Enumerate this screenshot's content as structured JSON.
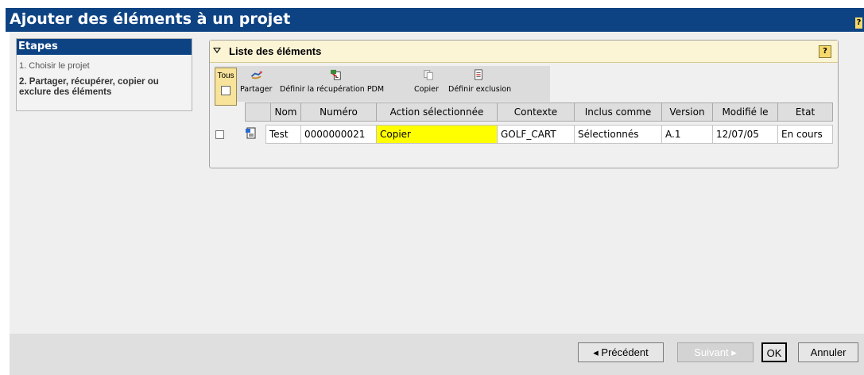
{
  "window": {
    "title": "Ajouter des éléments à un projet",
    "help_label": "?"
  },
  "steps": {
    "header": "Etapes",
    "items": [
      {
        "label": "1. Choisir le projet",
        "active": false
      },
      {
        "label": "2. Partager, récupérer, copier ou exclure des éléments",
        "active": true
      }
    ]
  },
  "elements_panel": {
    "title": "Liste des éléments",
    "help_label": "?",
    "toolbar": {
      "select_all_label": "Tous",
      "buttons": [
        {
          "label": "Partager",
          "icon": "share-icon"
        },
        {
          "label": "Définir la récupération PDM",
          "icon": "retrieve-pdm-icon"
        },
        {
          "label": "Copier",
          "icon": "copy-icon"
        },
        {
          "label": "Définir exclusion",
          "icon": "exclusion-icon"
        }
      ]
    },
    "table": {
      "columns": [
        "Nom",
        "Numéro",
        "Action sélectionnée",
        "Contexte",
        "Inclus comme",
        "Version",
        "Modifié le",
        "Etat"
      ],
      "rows": [
        {
          "checked": false,
          "icon": "document-icon",
          "nom": "Test",
          "numero": "0000000021",
          "action": "Copier",
          "contexte": "GOLF_CART",
          "inclus_comme": "Sélectionnés",
          "version": "A.1",
          "modifie_le": "12/07/05",
          "etat": "En cours"
        }
      ]
    }
  },
  "footer": {
    "previous": "◂ Précédent",
    "next": "Suivant ▸",
    "ok": "OK",
    "cancel": "Annuler"
  },
  "colors": {
    "title_bar": "#0d4383",
    "action_highlight": "#ffff00",
    "panel_header": "#fbf5d6"
  }
}
